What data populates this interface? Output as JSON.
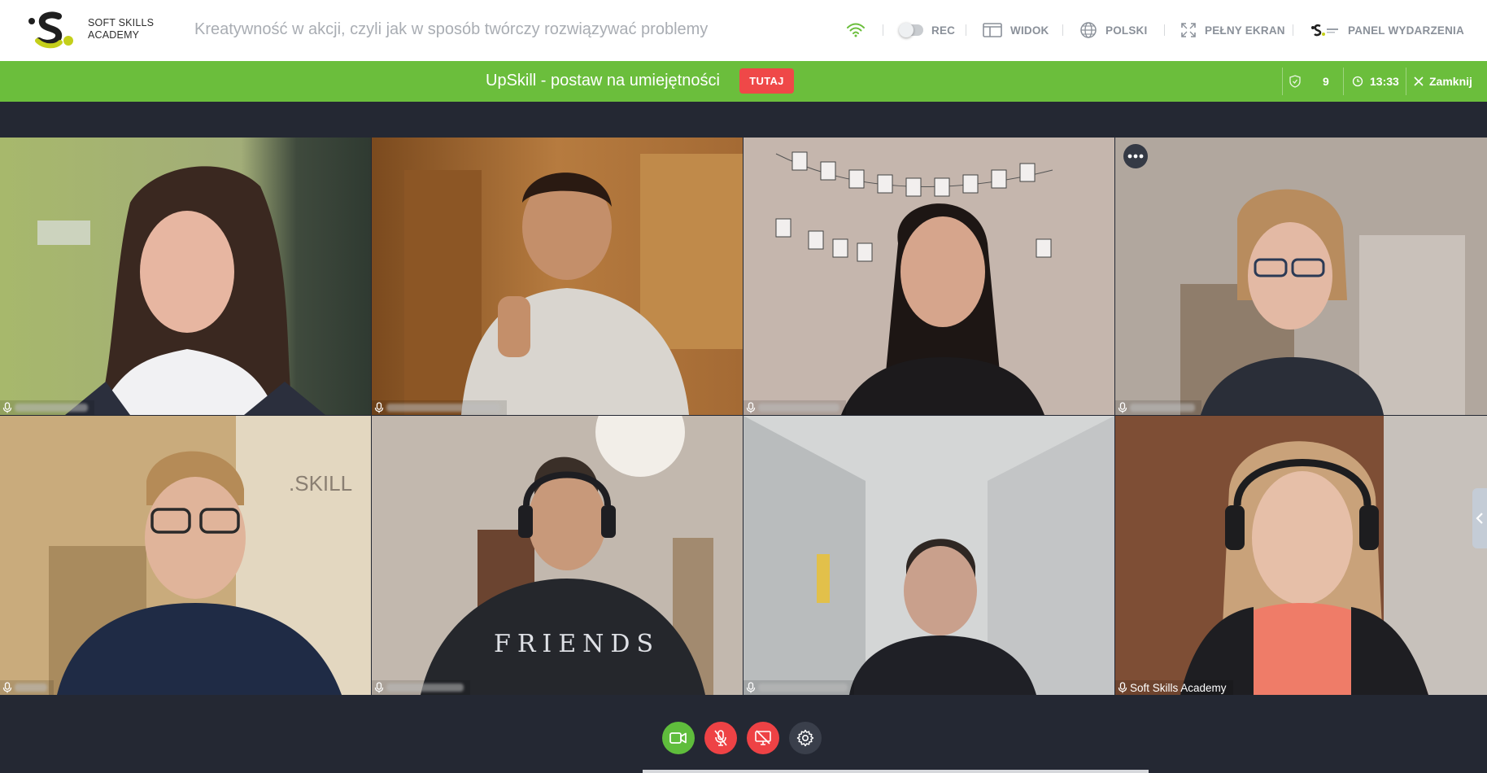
{
  "header": {
    "logo_text_line1": "SOFT SKILLS",
    "logo_text_line2": "ACADEMY",
    "event_title": "Kreatywność w akcji, czyli jak w sposób twórczy rozwiązywać problemy",
    "rec_label": "REC",
    "view_label": "WIDOK",
    "language_label": "POLSKI",
    "fullscreen_label": "PEŁNY EKRAN",
    "event_panel_label": "PANEL WYDARZENIA",
    "icons": [
      "wifi-icon",
      "toggle-icon",
      "window-icon",
      "globe-icon",
      "expand-icon",
      "brand-icon"
    ]
  },
  "banner": {
    "text": "UpSkill - postaw na umiejętności",
    "button_label": "TUTAJ",
    "participants_count": "9",
    "time": "13:33",
    "close_label": "Zamknij"
  },
  "tiles": [
    {
      "name": "",
      "bg": "#8f9d6a"
    },
    {
      "name": "",
      "bg": "#8a5a2b"
    },
    {
      "name": "",
      "bg": "#b9a69a"
    },
    {
      "name": "",
      "bg": "#9b8f84"
    },
    {
      "name": "",
      "bg": "#b79a6f"
    },
    {
      "name": "",
      "bg": "#8e7d72"
    },
    {
      "name": "",
      "bg": "#a2a4a6"
    },
    {
      "name": "Soft Skills Academy",
      "bg": "#8c5b44"
    }
  ],
  "colors": {
    "brand_green": "#6bbe3c",
    "stage_bg": "#242833",
    "danger_red": "#ef4848"
  },
  "controls": {
    "icons": [
      "video-camera-icon",
      "mic-off-icon",
      "screen-share-off-icon",
      "gear-icon"
    ]
  }
}
